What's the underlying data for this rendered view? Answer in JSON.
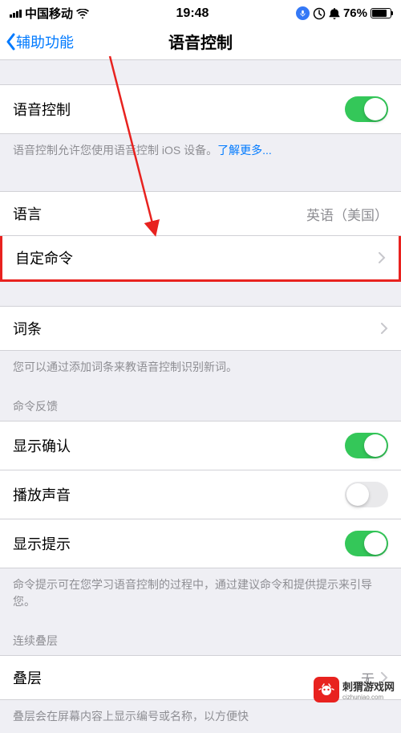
{
  "status": {
    "carrier": "中国移动",
    "time": "19:48",
    "batt": "76%"
  },
  "nav": {
    "back": "辅助功能",
    "title": "语音控制"
  },
  "voice": {
    "label": "语音控制",
    "desc": "语音控制允许您使用语音控制 iOS 设备。",
    "link": "了解更多...",
    "on": true
  },
  "language": {
    "label": "语言",
    "value": "英语（美国）"
  },
  "custom": {
    "label": "自定命令"
  },
  "words": {
    "label": "词条",
    "desc": "您可以通过添加词条来教语音控制识别新词。"
  },
  "feedback": {
    "header": "命令反馈",
    "confirm": "显示确认",
    "sound": "播放声音",
    "hints": "显示提示",
    "desc": "命令提示可在您学习语音控制的过程中，通过建议命令和提供提示来引导您。"
  },
  "overlay": {
    "header": "连续叠层",
    "label": "叠层",
    "value": "无",
    "desc": "叠层会在屏幕内容上显示编号或名称，以方便快"
  },
  "wm": {
    "name": "刺猬游戏网",
    "url": "cizhuniao.com"
  }
}
